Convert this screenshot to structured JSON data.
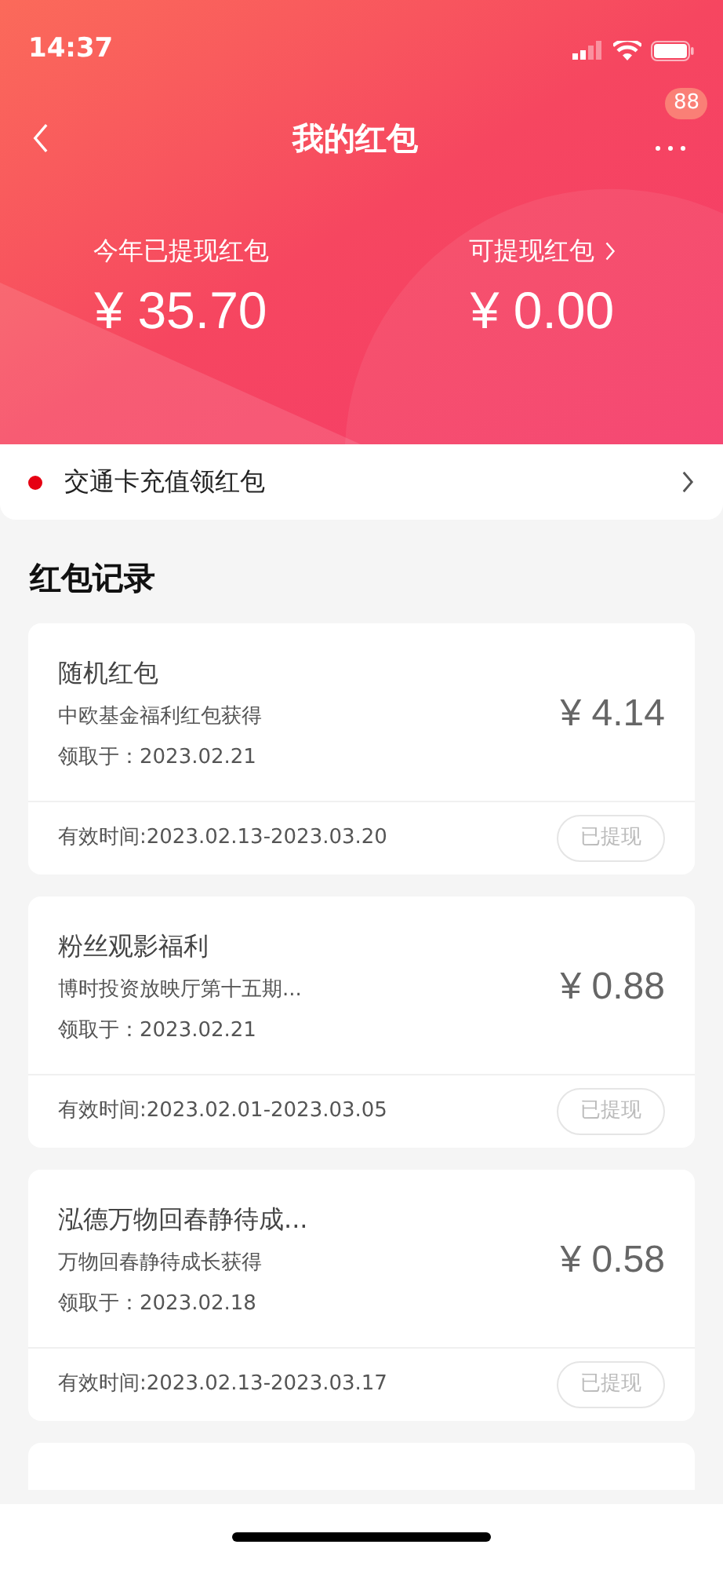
{
  "status_bar": {
    "time": "14:37"
  },
  "nav": {
    "title": "我的红包",
    "badge": "88"
  },
  "summary": [
    {
      "label": "今年已提现红包",
      "amount": "¥ 35.70",
      "has_arrow": false
    },
    {
      "label": "可提现红包",
      "amount": "¥ 0.00",
      "has_arrow": true
    }
  ],
  "banner": {
    "text": "交通卡充值领红包"
  },
  "section_title": "红包记录",
  "records": [
    {
      "title": "随机红包",
      "source": "中欧基金福利红包获得",
      "received": "领取于：2023.02.21",
      "amount": "¥ 4.14",
      "validity": "有效时间:2023.02.13-2023.03.20",
      "button": "已提现"
    },
    {
      "title": "粉丝观影福利",
      "source": "博时投资放映厅第十五期...",
      "received": "领取于：2023.02.21",
      "amount": "¥ 0.88",
      "validity": "有效时间:2023.02.01-2023.03.05",
      "button": "已提现"
    },
    {
      "title": "泓德万物回春静待成...",
      "source": "万物回春静待成长获得",
      "received": "领取于：2023.02.18",
      "amount": "¥ 0.58",
      "validity": "有效时间:2023.02.13-2023.03.17",
      "button": "已提现"
    }
  ]
}
